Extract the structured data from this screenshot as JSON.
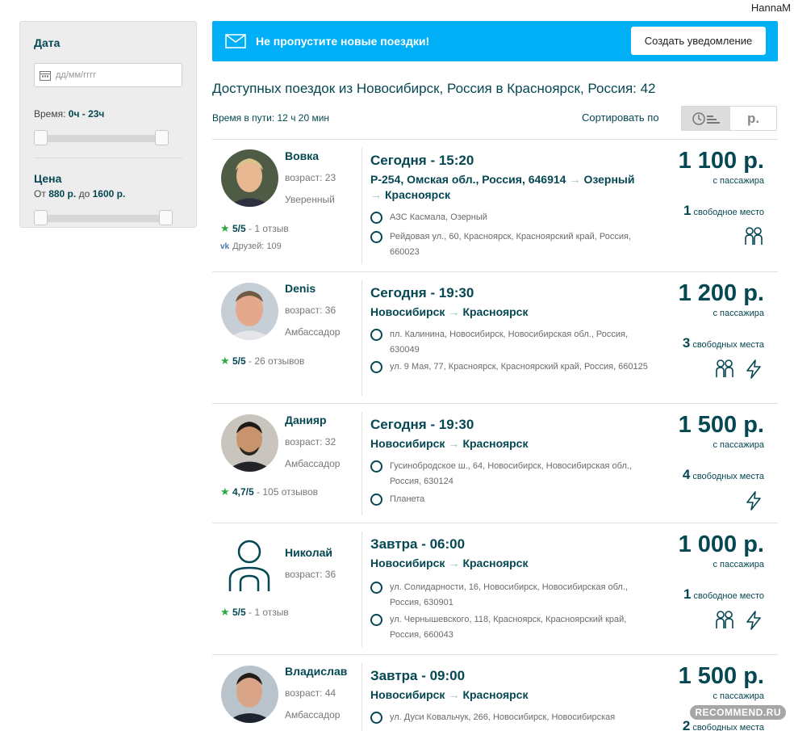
{
  "user": "HannaM",
  "sidebar": {
    "date_title": "Дата",
    "date_placeholder": "дд/мм/гггг",
    "time_label": "Время:",
    "time_range": "0ч - 23ч",
    "price_title": "Цена",
    "price_from_label": "От",
    "price_from": "880 р.",
    "price_to_label": "до",
    "price_to": "1600 р."
  },
  "banner": {
    "text": "Не пропустите новые поездки!",
    "button": "Создать уведомление"
  },
  "heading": "Доступных поездок из Новосибирск, Россия в Красноярск, Россия: 42",
  "travel_time": "Время в пути: 12 ч 20 мин",
  "sort": {
    "label": "Сортировать по",
    "price_option": "р."
  },
  "trips": [
    {
      "driver": "Вовка",
      "age": "возраст: 23",
      "level": "Уверенный",
      "rating": "5/5",
      "reviews": "- 1 отзыв",
      "friends": "Друзей: 109",
      "time": "Сегодня - 15:20",
      "from": "Р-254, Омская обл., Россия, 646914",
      "to_head": "Озерный",
      "to": "Красноярск",
      "stops": [
        "АЗС Касмала, Озерный",
        "Рейдовая ул., 60, Красноярск, Красноярский край, Россия, 660023"
      ],
      "price": "1 100 р.",
      "per": "с пассажира",
      "seat_count": "1",
      "seat_label": "свободное место",
      "icons": [
        "two-passengers-icon"
      ]
    },
    {
      "driver": "Denis",
      "age": "возраст: 36",
      "level": "Амбассадор",
      "rating": "5/5",
      "reviews": "- 26 отзывов",
      "time": "Сегодня - 19:30",
      "from": "Новосибирск",
      "to": "Красноярск",
      "stops": [
        "пл. Калинина, Новосибирск, Новосибирская обл., Россия, 630049",
        "ул. 9 Мая, 77, Красноярск, Красноярский край, Россия, 660125"
      ],
      "price": "1 200 р.",
      "per": "с пассажира",
      "seat_count": "3",
      "seat_label": "свободных места",
      "icons": [
        "two-passengers-icon",
        "lightning-icon"
      ]
    },
    {
      "driver": "Данияр",
      "age": "возраст: 32",
      "level": "Амбассадор",
      "rating": "4,7/5",
      "reviews": "- 105 отзывов",
      "time": "Сегодня - 19:30",
      "from": "Новосибирск",
      "to": "Красноярск",
      "stops": [
        "Гусинобродское ш., 64, Новосибирск, Новосибирская обл., Россия, 630124",
        "Планета"
      ],
      "price": "1 500 р.",
      "per": "с пассажира",
      "seat_count": "4",
      "seat_label": "свободных места",
      "icons": [
        "lightning-icon"
      ]
    },
    {
      "driver": "Николай",
      "age": "возраст: 36",
      "rating": "5/5",
      "reviews": "- 1 отзыв",
      "time": "Завтра - 06:00",
      "from": "Новосибирск",
      "to": "Красноярск",
      "stops": [
        "ул. Солидарности, 16, Новосибирск, Новосибирская обл., Россия, 630901",
        "ул. Чернышевского, 118, Красноярск, Красноярский край, Россия, 660043"
      ],
      "price": "1 000 р.",
      "per": "с пассажира",
      "seat_count": "1",
      "seat_label": "свободное место",
      "icons": [
        "two-passengers-icon",
        "lightning-icon"
      ]
    },
    {
      "driver": "Владислав",
      "age": "возраст: 44",
      "level": "Амбассадор",
      "time": "Завтра - 09:00",
      "from": "Новосибирск",
      "to": "Красноярск",
      "stops": [
        "ул. Дуси Ковальчук, 266, Новосибирск, Новосибирская"
      ],
      "price": "1 500 р.",
      "per": "с пассажира",
      "seat_count": "2",
      "seat_label": "свободных места"
    }
  ],
  "watermark": "RECOMMEND.RU"
}
